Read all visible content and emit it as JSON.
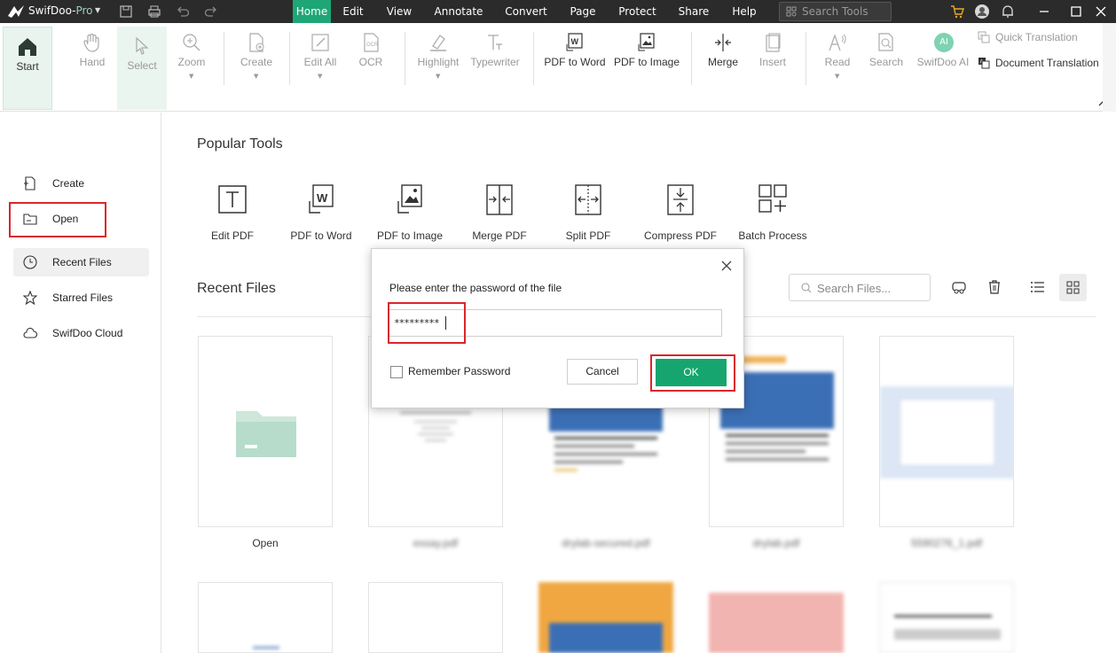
{
  "titlebar": {
    "app_name_main": "SwifDoo-",
    "app_name_suffix": "Pro",
    "menu": [
      "Home",
      "Edit",
      "View",
      "Annotate",
      "Convert",
      "Page",
      "Protect",
      "Share",
      "Help"
    ],
    "active_menu": "Home",
    "search_placeholder": "Search Tools"
  },
  "ribbon": {
    "buttons": [
      "Start",
      "Hand",
      "Select",
      "Zoom",
      "Create",
      "Edit All",
      "OCR",
      "Highlight",
      "Typewriter",
      "PDF to Word",
      "PDF to Image",
      "Merge",
      "Insert",
      "Read",
      "Search",
      "SwifDoo AI"
    ],
    "ai_badge": "AI",
    "quick_translation": "Quick Translation",
    "document_translation": "Document Translation"
  },
  "sidebar": {
    "items": [
      {
        "label": "Create",
        "icon": "create-file-icon"
      },
      {
        "label": "Open",
        "icon": "folder-icon"
      },
      {
        "label": "Recent Files",
        "icon": "clock-icon"
      },
      {
        "label": "Starred Files",
        "icon": "star-icon"
      },
      {
        "label": "SwifDoo Cloud",
        "icon": "cloud-icon"
      }
    ]
  },
  "main": {
    "popular_title": "Popular Tools",
    "tools": [
      "Edit PDF",
      "PDF to Word",
      "PDF to Image",
      "Merge PDF",
      "Split PDF",
      "Compress PDF",
      "Batch Process"
    ],
    "recent_title": "Recent Files",
    "search_files_placeholder": "Search Files...",
    "files": [
      {
        "label": "Open"
      },
      {
        "label": "essay.pdf"
      },
      {
        "label": "drylab-secured.pdf"
      },
      {
        "label": "drylab.pdf"
      },
      {
        "label": "5590276_1.pdf"
      }
    ]
  },
  "dialog": {
    "prompt": "Please enter the password of the file",
    "password_value": "*********",
    "remember_label": "Remember Password",
    "remember_checked": false,
    "cancel_label": "Cancel",
    "ok_label": "OK"
  },
  "colors": {
    "accent": "#16a56f",
    "titlebar_bg": "#2b2b2b",
    "highlight_box": "#d9262c"
  }
}
